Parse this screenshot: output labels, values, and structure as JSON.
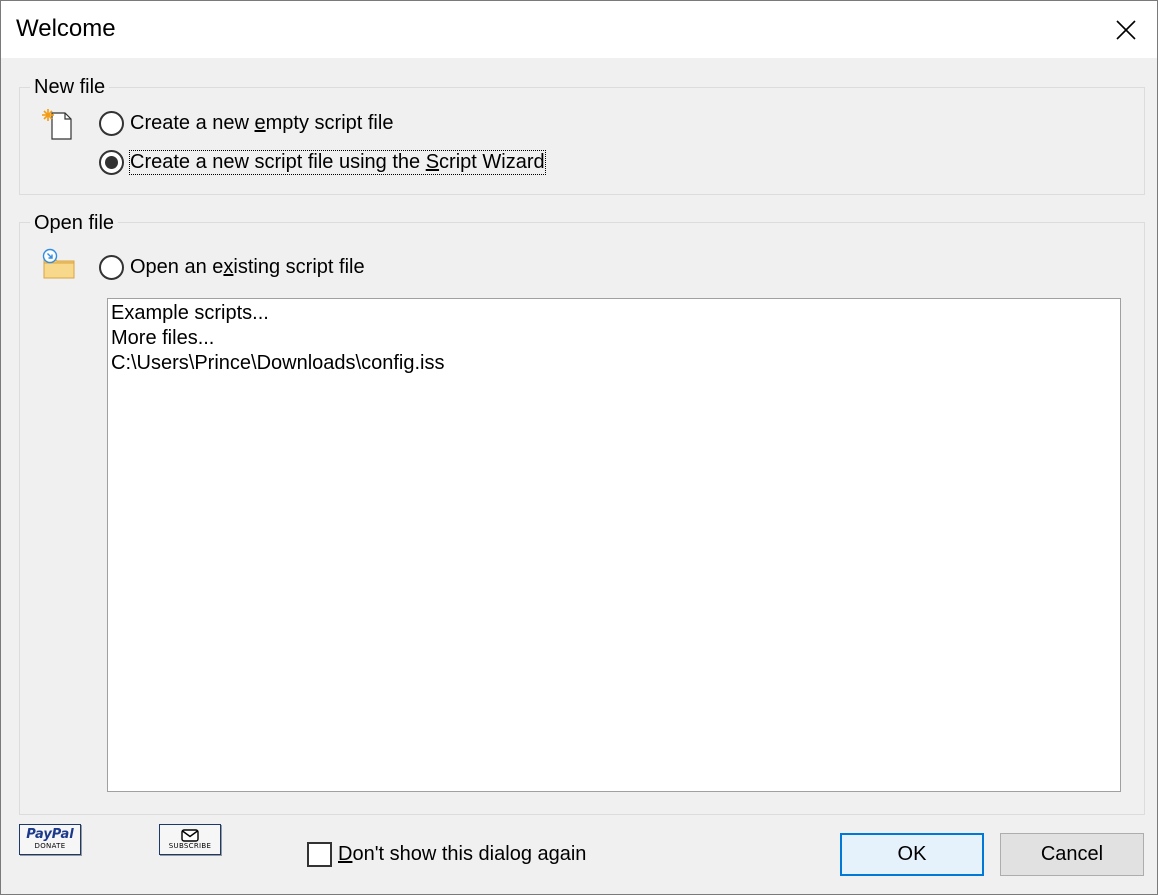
{
  "window": {
    "title": "Welcome"
  },
  "new_file": {
    "group_label": "New file",
    "options": [
      {
        "pre": "Create a new ",
        "mnemonic": "e",
        "post": "mpty script file",
        "checked": false
      },
      {
        "pre": "Create a new script file using the ",
        "mnemonic": "S",
        "post": "cript Wizard",
        "checked": true
      }
    ]
  },
  "open_file": {
    "group_label": "Open file",
    "option": {
      "pre": "Open an e",
      "mnemonic": "x",
      "post": "isting script file",
      "checked": false
    },
    "list_items": [
      "Example scripts...",
      "More files...",
      "C:\\Users\\Prince\\Downloads\\config.iss"
    ]
  },
  "footer": {
    "paypal": {
      "big": "PayPal",
      "small": "DONATE"
    },
    "subscribe": {
      "small": "SUBSCRIBE"
    },
    "dont_show": {
      "mnemonic": "D",
      "post": "on't show this dialog again",
      "checked": false
    },
    "ok_label": "OK",
    "cancel_label": "Cancel"
  },
  "colors": {
    "accent": "#0078d7",
    "background": "#f0f0f0",
    "icon_orange": "#f39c12",
    "folder_yellow": "#f5c76a"
  }
}
